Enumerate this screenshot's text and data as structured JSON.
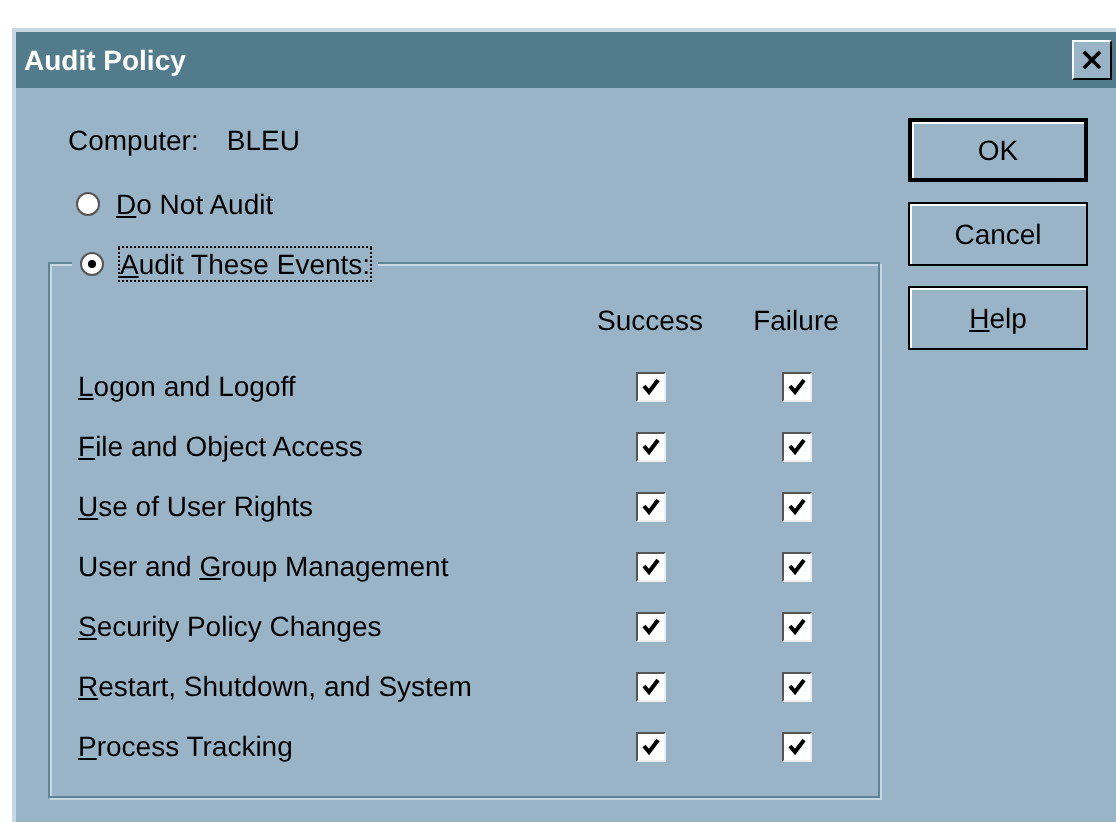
{
  "window": {
    "title": "Audit Policy",
    "close": "×"
  },
  "computer": {
    "label": "Computer:",
    "value": "BLEU"
  },
  "options": [
    {
      "key": "D",
      "rest": "o Not Audit",
      "selected": false
    },
    {
      "key": "A",
      "rest": "udit These Events:",
      "selected": true
    }
  ],
  "columns": [
    "Success",
    "Failure"
  ],
  "events": [
    {
      "key": "L",
      "rest": "ogon and Logoff",
      "success": true,
      "failure": true
    },
    {
      "key": "F",
      "rest": "ile and Object Access",
      "success": true,
      "failure": true
    },
    {
      "key": "U",
      "rest": "se of User Rights",
      "success": true,
      "failure": true
    },
    {
      "before": "User and ",
      "key": "G",
      "rest": "roup Management",
      "success": true,
      "failure": true
    },
    {
      "key": "S",
      "rest": "ecurity Policy Changes",
      "success": true,
      "failure": true
    },
    {
      "key": "R",
      "rest": "estart, Shutdown, and System",
      "success": true,
      "failure": true
    },
    {
      "key": "P",
      "rest": "rocess Tracking",
      "success": true,
      "failure": true
    }
  ],
  "buttons": [
    {
      "rest": "OK",
      "default": true
    },
    {
      "rest": "Cancel",
      "default": false
    },
    {
      "key": "H",
      "rest": "elp",
      "default": false
    }
  ]
}
